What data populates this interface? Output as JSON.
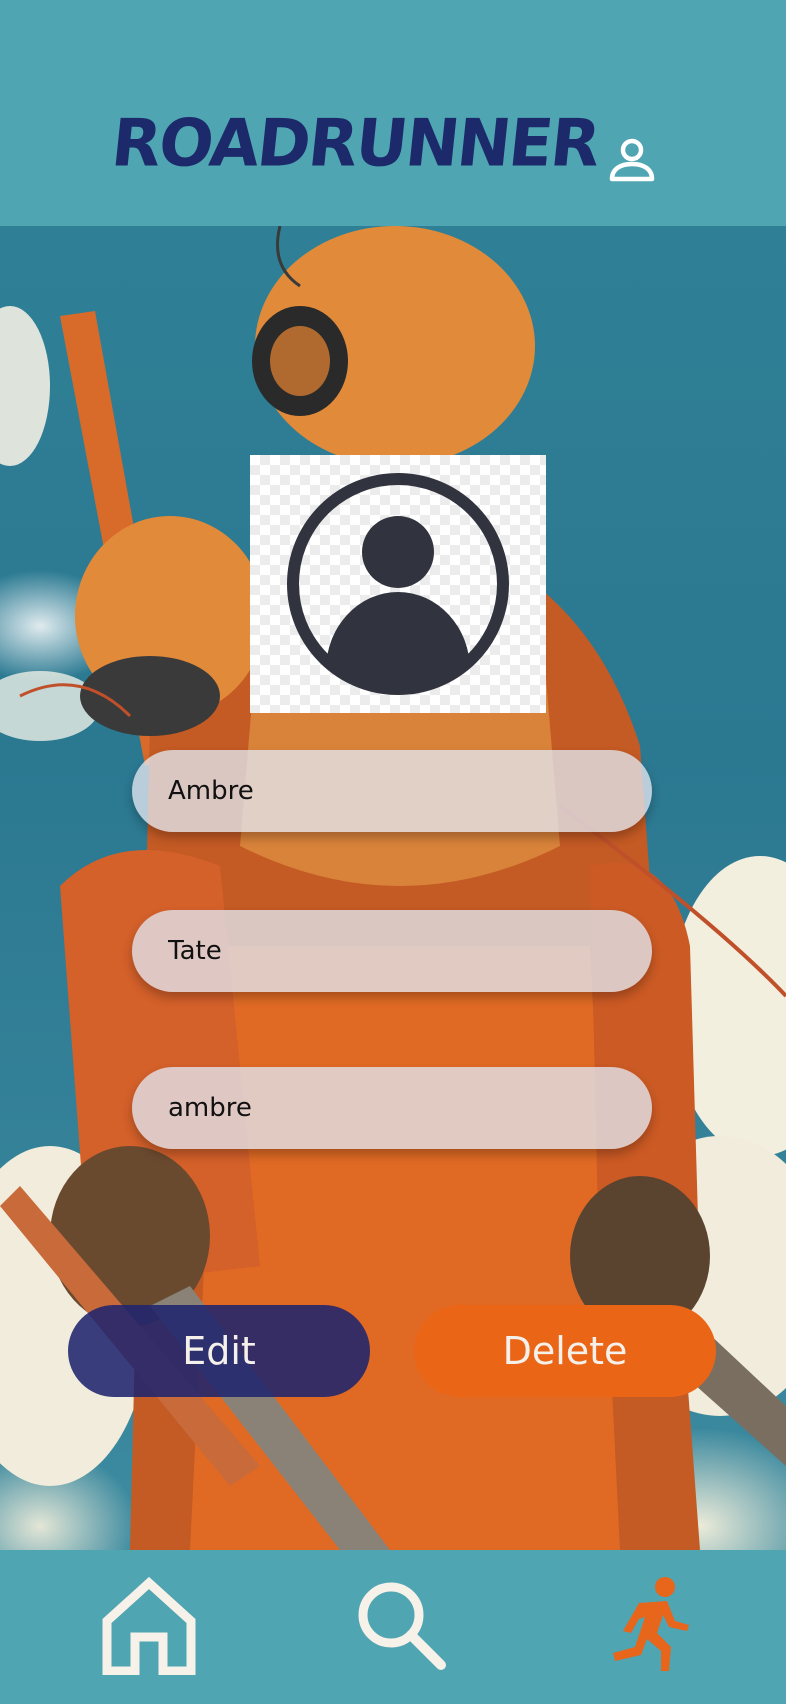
{
  "header": {
    "brand": "ROADRUNNER",
    "profile_icon": "person-outline-icon"
  },
  "avatar": {
    "icon": "user-circle-icon"
  },
  "form": {
    "first_name": "Ambre",
    "last_name": "Tate",
    "username": "ambre"
  },
  "actions": {
    "edit_label": "Edit",
    "delete_label": "Delete"
  },
  "nav": {
    "items": [
      {
        "name": "home",
        "icon": "home-icon",
        "active": false
      },
      {
        "name": "search",
        "icon": "search-icon",
        "active": false
      },
      {
        "name": "runner",
        "icon": "running-person-icon",
        "active": true
      }
    ]
  },
  "colors": {
    "header_bg": "#4fa5b1",
    "brand": "#1c2a6b",
    "edit": "#1f246e",
    "delete": "#eb6516",
    "active_nav": "#e8651c",
    "nav_icon": "#f6f1e9"
  }
}
